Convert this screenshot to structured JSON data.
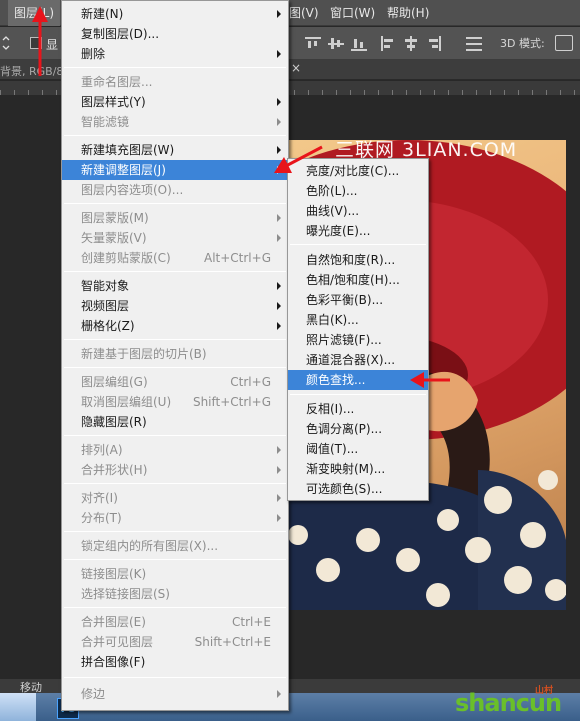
{
  "menubar": {
    "items": [
      {
        "label": "图层(L)",
        "active": true
      },
      {
        "label": "图(V)"
      },
      {
        "label": "窗口(W)"
      },
      {
        "label": "帮助(H)"
      }
    ]
  },
  "optionsbar": {
    "checkbox_label": "显",
    "mode_label": "3D 模式:"
  },
  "document": {
    "tab_label": "背景, RGB/8",
    "tab_close": "×"
  },
  "layer_menu": {
    "items": [
      {
        "label": "新建(N)",
        "submenu": true
      },
      {
        "label": "复制图层(D)..."
      },
      {
        "label": "删除",
        "submenu": true
      },
      {
        "label": "重命名图层...",
        "disabled": true
      },
      {
        "label": "图层样式(Y)",
        "submenu": true
      },
      {
        "label": "智能滤镜",
        "submenu": true,
        "disabled": true
      },
      {
        "label": "新建填充图层(W)",
        "submenu": true
      },
      {
        "label": "新建调整图层(J)",
        "submenu": true,
        "highlighted": true
      },
      {
        "label": "图层内容选项(O)...",
        "disabled": true
      },
      {
        "label": "图层蒙版(M)",
        "submenu": true,
        "disabled": true
      },
      {
        "label": "矢量蒙版(V)",
        "submenu": true,
        "disabled": true
      },
      {
        "label": "创建剪贴蒙版(C)",
        "shortcut": "Alt+Ctrl+G",
        "disabled": true
      },
      {
        "label": "智能对象",
        "submenu": true
      },
      {
        "label": "视频图层",
        "submenu": true
      },
      {
        "label": "栅格化(Z)",
        "submenu": true
      },
      {
        "label": "新建基于图层的切片(B)",
        "disabled": true
      },
      {
        "label": "图层编组(G)",
        "shortcut": "Ctrl+G",
        "disabled": true
      },
      {
        "label": "取消图层编组(U)",
        "shortcut": "Shift+Ctrl+G",
        "disabled": true
      },
      {
        "label": "隐藏图层(R)"
      },
      {
        "label": "排列(A)",
        "submenu": true,
        "disabled": true
      },
      {
        "label": "合并形状(H)",
        "submenu": true,
        "disabled": true
      },
      {
        "label": "对齐(I)",
        "submenu": true,
        "disabled": true
      },
      {
        "label": "分布(T)",
        "submenu": true,
        "disabled": true
      },
      {
        "label": "锁定组内的所有图层(X)...",
        "disabled": true
      },
      {
        "label": "链接图层(K)",
        "disabled": true
      },
      {
        "label": "选择链接图层(S)",
        "disabled": true
      },
      {
        "label": "合并图层(E)",
        "shortcut": "Ctrl+E",
        "disabled": true
      },
      {
        "label": "合并可见图层",
        "shortcut": "Shift+Ctrl+E",
        "disabled": true
      },
      {
        "label": "拼合图像(F)"
      },
      {
        "label": "修边",
        "submenu": true,
        "disabled": true
      }
    ]
  },
  "adjust_menu": {
    "items": [
      {
        "label": "亮度/对比度(C)..."
      },
      {
        "label": "色阶(L)..."
      },
      {
        "label": "曲线(V)..."
      },
      {
        "label": "曝光度(E)..."
      },
      {
        "label": "自然饱和度(R)..."
      },
      {
        "label": "色相/饱和度(H)..."
      },
      {
        "label": "色彩平衡(B)..."
      },
      {
        "label": "黑白(K)..."
      },
      {
        "label": "照片滤镜(F)..."
      },
      {
        "label": "通道混合器(X)..."
      },
      {
        "label": "颜色查找...",
        "highlighted": true
      },
      {
        "label": "反相(I)..."
      },
      {
        "label": "色调分离(P)..."
      },
      {
        "label": "阈值(T)..."
      },
      {
        "label": "渐变映射(M)..."
      },
      {
        "label": "可选颜色(S)..."
      }
    ]
  },
  "photo": {
    "watermark": "三联网 3LIAN.COM"
  },
  "statusbar": {
    "tool_label": "移动"
  },
  "taskbar": {
    "ps_label": "Ps"
  },
  "brand": {
    "name": "shancun",
    "tag": "山村"
  },
  "colors": {
    "menu_bg": "#f0f0f0",
    "highlight": "#3c84d8",
    "annotation_red": "#e8141b"
  }
}
